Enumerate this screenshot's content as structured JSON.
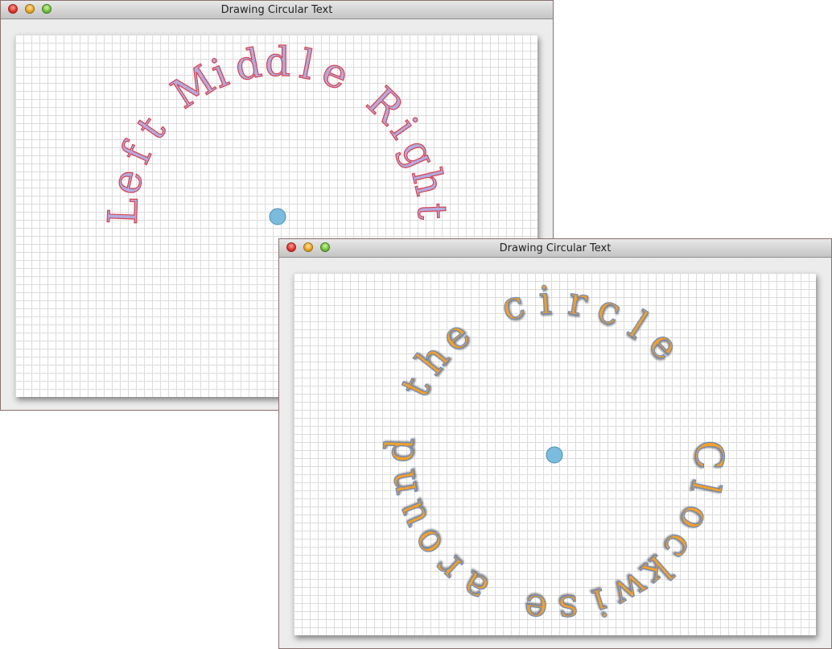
{
  "windows": [
    {
      "title": "Drawing Circular Text",
      "text": "Left Middle Right",
      "fill": "#b2abdd",
      "stroke": "#d94050",
      "center_dot_color": "#7bbbdd"
    },
    {
      "title": "Drawing Circular Text",
      "text": "Clockwise around the circle",
      "fill": "#f0a02c",
      "stroke": "#6a86b8",
      "center_dot_color": "#7bbbdd"
    }
  ]
}
